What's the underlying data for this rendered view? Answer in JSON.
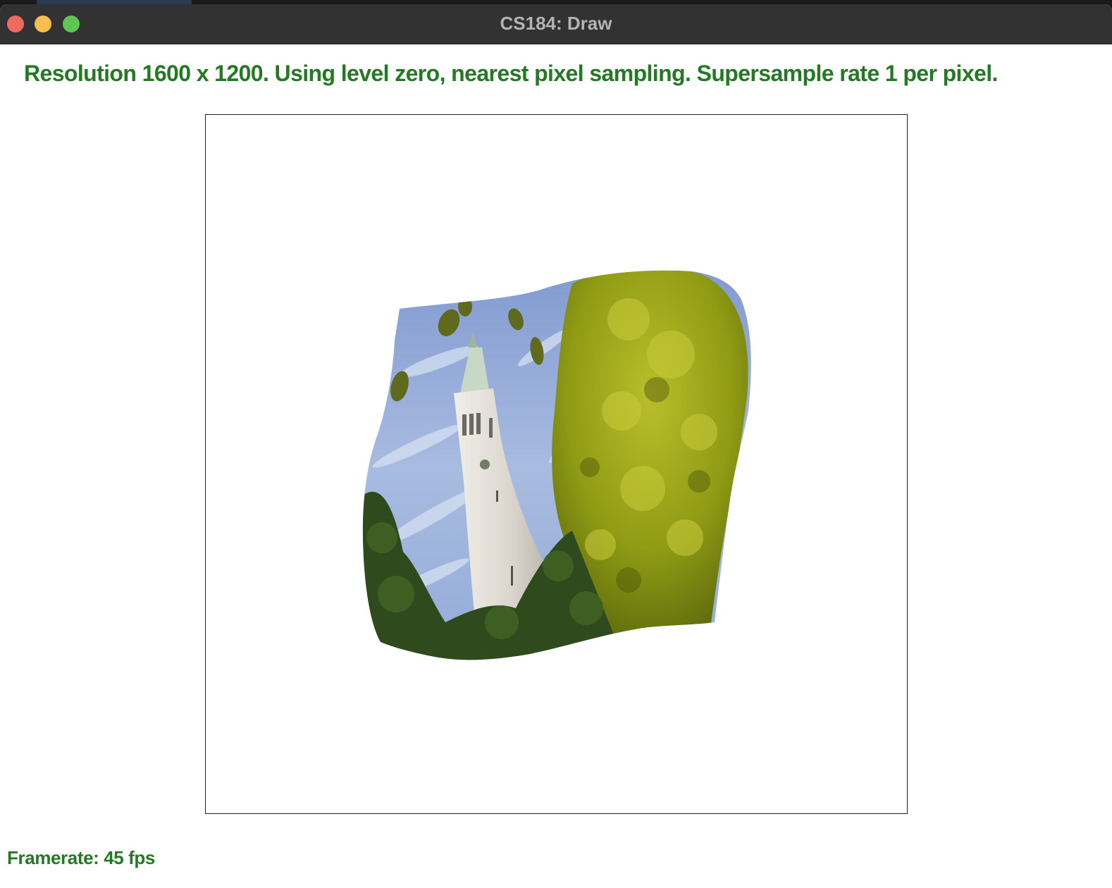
{
  "window": {
    "title": "CS184: Draw"
  },
  "status": {
    "text": "Resolution 1600 x 1200. Using level zero, nearest pixel sampling. Supersample rate 1 per pixel."
  },
  "footer": {
    "framerate": "Framerate: 45 fps"
  },
  "colors": {
    "status_text": "#237a23",
    "sky": "#8fa9d6",
    "foliage": "#9aa91a",
    "tower": "#e4e1da"
  }
}
